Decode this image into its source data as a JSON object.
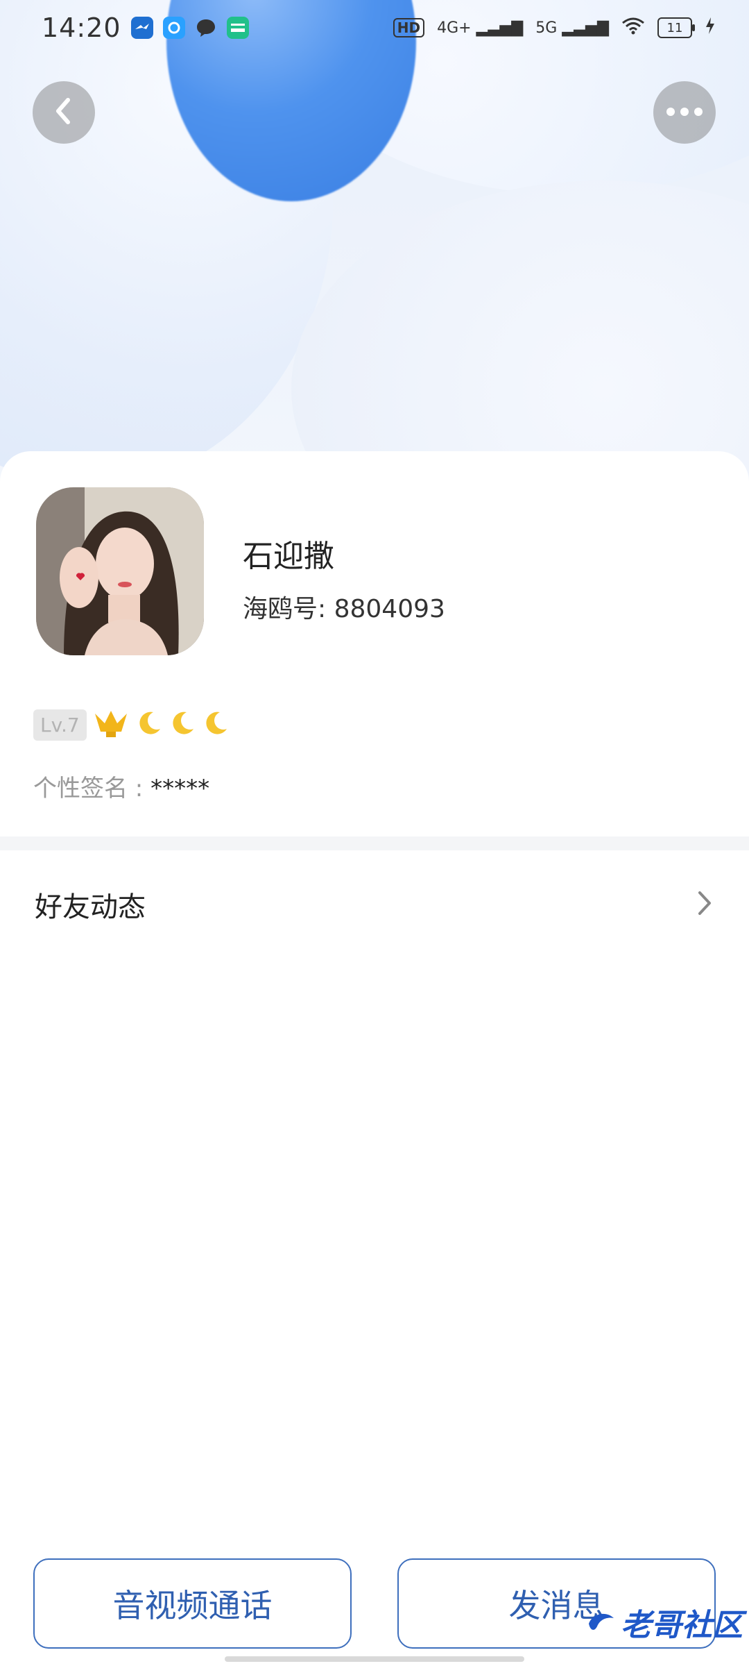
{
  "status_bar": {
    "time": "14:20",
    "network1": "4G+",
    "network2": "5G",
    "hd": "HD",
    "battery": "11"
  },
  "profile": {
    "name": "石迎撒",
    "id_label": "海鸥号: 8804093",
    "level": "Lv.7",
    "signature_label": "个性签名 : ",
    "signature_value": "*****"
  },
  "sections": {
    "moments": "好友动态"
  },
  "actions": {
    "call": "音视频通话",
    "message": "发消息"
  },
  "watermark": "老哥社区",
  "colors": {
    "accent": "#2f5fb0",
    "bubble_blue": "#4f93ee"
  }
}
